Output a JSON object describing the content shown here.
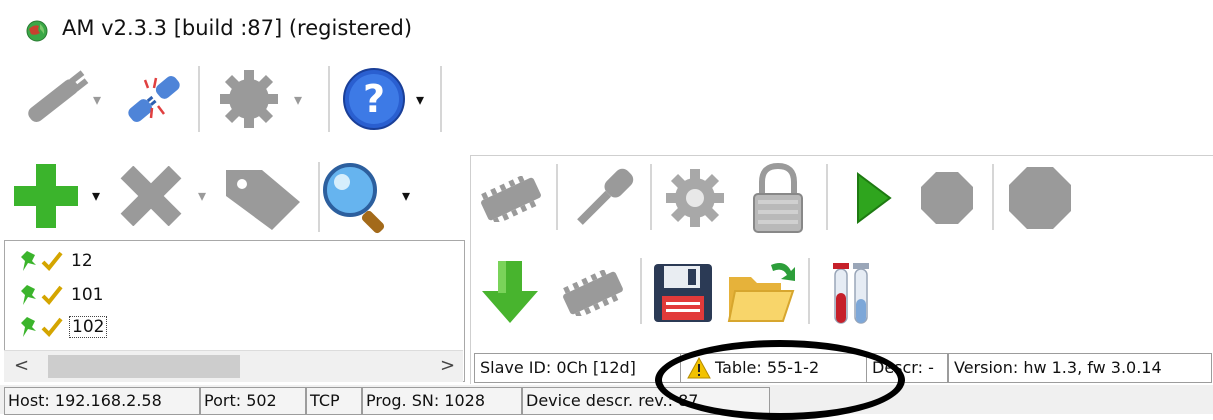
{
  "window": {
    "title": "AM v2.3.3 [build :87] (registered)",
    "icon": "app-globe-icon"
  },
  "toolbar_top": {
    "items": [
      {
        "name": "connect-plug-icon",
        "has_dropdown": true
      },
      {
        "name": "disconnect-plug-icon",
        "has_dropdown": false
      },
      {
        "name": "settings-gear-icon",
        "has_dropdown": true
      },
      {
        "name": "help-icon",
        "has_dropdown": true
      }
    ]
  },
  "toolbar_left": {
    "items": [
      {
        "name": "add-icon",
        "has_dropdown": true
      },
      {
        "name": "remove-icon",
        "has_dropdown": true
      },
      {
        "name": "tag-icon",
        "has_dropdown": false
      },
      {
        "name": "search-icon",
        "has_dropdown": true
      }
    ]
  },
  "toolbar_right_top": {
    "items": [
      "chip-icon",
      "screwdriver-icon",
      "gear-icon",
      "lock-icon",
      "play-icon",
      "stop-icon",
      "stop-large-icon"
    ]
  },
  "toolbar_right_bottom": {
    "items": [
      "download-arrow-icon",
      "chip-icon",
      "save-floppy-icon",
      "open-folder-icon",
      "test-tubes-icon"
    ]
  },
  "tree": {
    "items": [
      {
        "label": "12",
        "selected": false
      },
      {
        "label": "101",
        "selected": false
      },
      {
        "label": "102",
        "selected": true
      }
    ]
  },
  "device_status": {
    "slave_id": "Slave ID: 0Ch [12d]",
    "table": "Table: 55-1-2",
    "descr": "Descr: -",
    "version": "Version: hw 1.3, fw 3.0.14"
  },
  "status_bar": {
    "host": "Host: 192.168.2.58",
    "port": "Port: 502",
    "protocol": "TCP",
    "prog_sn": "Prog. SN: 1028",
    "device_descr_rev": "Device descr. rev.: 87"
  },
  "colors": {
    "accent_green": "#3bb42c",
    "warning_yellow": "#f2c200",
    "help_blue": "#2a5fd0",
    "disabled_gray": "#9a9a9a"
  }
}
